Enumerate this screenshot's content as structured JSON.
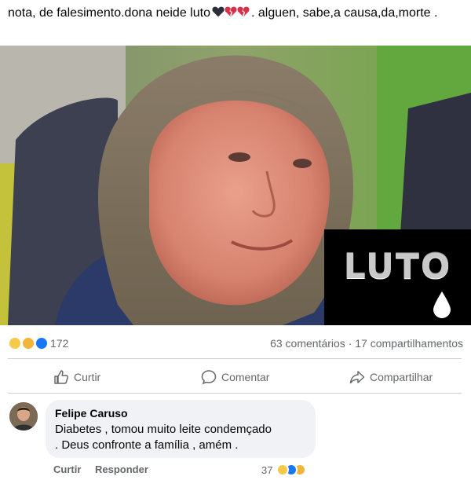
{
  "post": {
    "text_before": "nota,  de falesimento.dona neide luto",
    "text_after": ".  alguen, sabe,a causa,da,morte .",
    "heart_icons": [
      "black-heart-icon",
      "broken-heart-icon",
      "broken-heart-icon"
    ],
    "luto_label": "LUTO"
  },
  "reactions": {
    "icons": [
      "haha-icon",
      "sad-icon",
      "like-icon"
    ],
    "count": "172",
    "stats": "63 comentários · 17 compartilhamentos"
  },
  "actions": {
    "like": "Curtir",
    "comment": "Comentar",
    "share": "Compartilhar"
  },
  "comment": {
    "author": "Felipe Caruso",
    "text_line1": "Diabetes , tomou muito leite condemçado",
    "text_line2": ". Deus confronte a família , amém .",
    "like_label": "Curtir",
    "reply_label": "Responder",
    "reaction_count": "37",
    "reaction_icons": [
      "haha-icon",
      "like-icon",
      "sad-icon"
    ]
  },
  "colors": {
    "like_blue": "#1877f2",
    "emoji_yellow": "#f7c94a",
    "muted_text": "#65676b",
    "bubble_bg": "#f0f2f5"
  }
}
